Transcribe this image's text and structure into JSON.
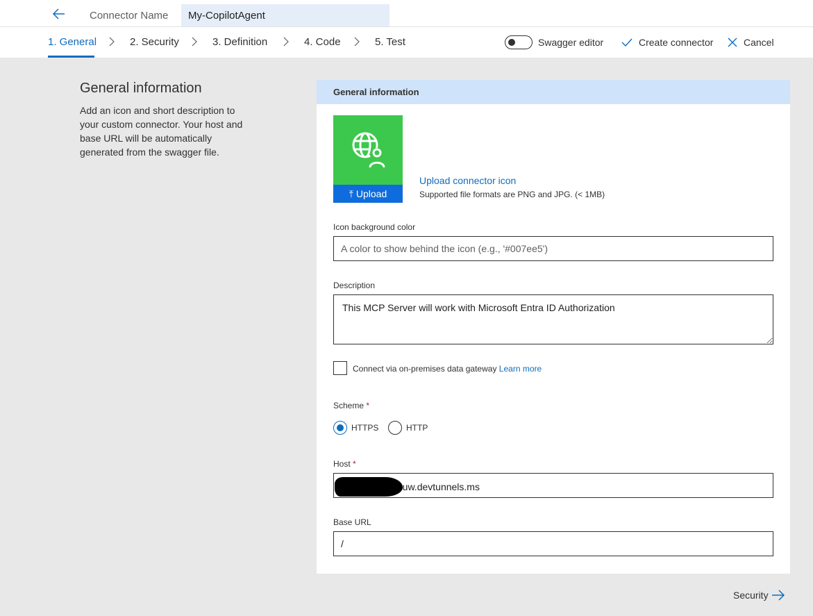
{
  "topbar": {
    "connector_label": "Connector Name",
    "connector_name": "My-CopilotAgent"
  },
  "steps": [
    {
      "label": "1. General"
    },
    {
      "label": "2. Security"
    },
    {
      "label": "3. Definition"
    },
    {
      "label": "4. Code"
    },
    {
      "label": "5. Test"
    }
  ],
  "toolbar": {
    "swagger_label": "Swagger editor",
    "swagger_on": false,
    "create_label": "Create connector",
    "cancel_label": "Cancel"
  },
  "side": {
    "title": "General information",
    "description": "Add an icon and short description to your custom connector. Your host and base URL will be automatically generated from the swagger file."
  },
  "card": {
    "header": "General information",
    "icon_bg": "#3cc84c",
    "icon_name": "globe-user-icon",
    "upload_label": "Upload",
    "upload_link": "Upload connector icon",
    "upload_note": "Supported file formats are PNG and JPG. (< 1MB)",
    "icon_bg_label": "Icon background color",
    "icon_bg_placeholder": "A color to show behind the icon (e.g., '#007ee5')",
    "description_label": "Description",
    "description_value": "This MCP Server will work with Microsoft Entra ID Authorization",
    "gateway_label": "Connect via on-premises data gateway",
    "gateway_link": "Learn more",
    "scheme_label": "Scheme",
    "required_mark": "*",
    "scheme_options": [
      "HTTPS",
      "HTTP"
    ],
    "scheme_selected": "HTTPS",
    "host_label": "Host",
    "host_value_visible": ".euw.devtunnels.ms",
    "base_url_label": "Base URL",
    "base_url_value": "/"
  },
  "footer": {
    "next_label": "Security"
  },
  "colors": {
    "accent": "#0f6cbd",
    "header_bg": "#cfe4fa",
    "page_bg": "#e8e8e8"
  }
}
